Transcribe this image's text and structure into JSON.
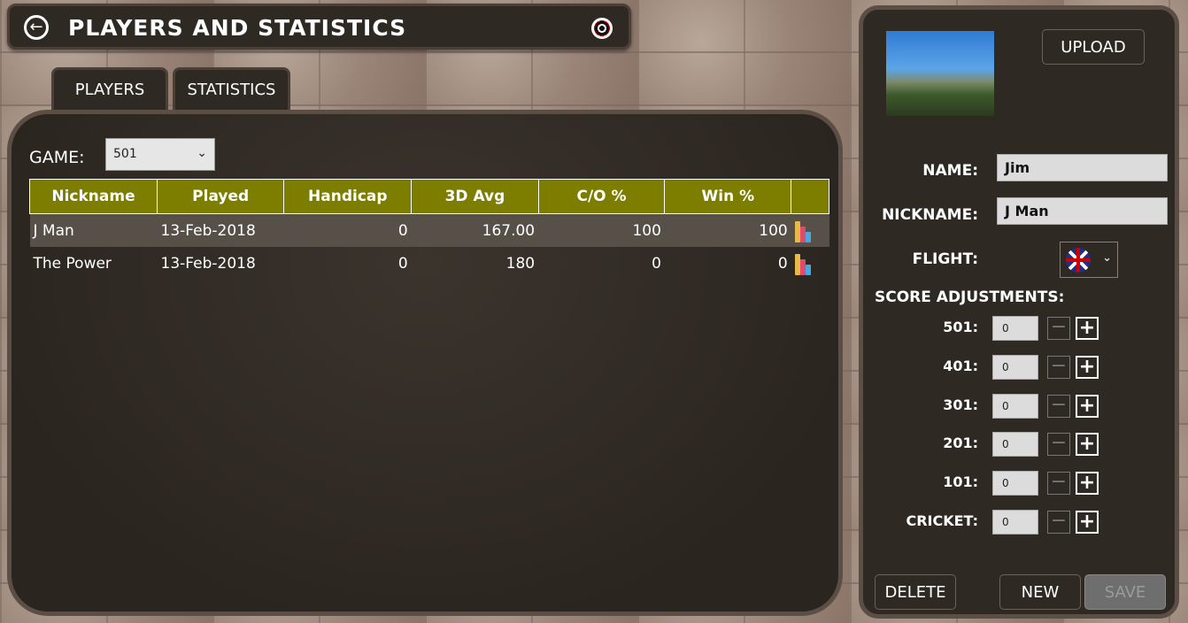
{
  "header": {
    "title": "PLAYERS AND STATISTICS",
    "back_icon": "arrow-left-icon",
    "dartboard_icon": "dartboard-icon"
  },
  "tabs": [
    {
      "label": "PLAYERS"
    },
    {
      "label": "STATISTICS"
    }
  ],
  "game": {
    "label": "GAME:",
    "selected": "501"
  },
  "table": {
    "columns": [
      "Nickname",
      "Played",
      "Handicap",
      "3D Avg",
      "C/O %",
      "Win %"
    ],
    "rows": [
      {
        "nickname": "J Man",
        "played": "13-Feb-2018",
        "handicap": "0",
        "avg": "167.00",
        "co": "100",
        "win": "100"
      },
      {
        "nickname": "The Power",
        "played": "13-Feb-2018",
        "handicap": "0",
        "avg": "180",
        "co": "0",
        "win": "0"
      }
    ]
  },
  "profile": {
    "upload_label": "UPLOAD",
    "name_label": "NAME:",
    "name_value": "Jim",
    "nickname_label": "NICKNAME:",
    "nickname_value": "J Man",
    "flight_label": "FLIGHT:",
    "flight_icon": "uk-flag-icon",
    "score_adjustments_label": "SCORE ADJUSTMENTS:",
    "adjustments": [
      {
        "label": "501:",
        "value": "0"
      },
      {
        "label": "401:",
        "value": "0"
      },
      {
        "label": "301:",
        "value": "0"
      },
      {
        "label": "201:",
        "value": "0"
      },
      {
        "label": "101:",
        "value": "0"
      },
      {
        "label": "CRICKET:",
        "value": "0"
      }
    ],
    "delete_label": "DELETE",
    "new_label": "NEW",
    "save_label": "SAVE"
  }
}
